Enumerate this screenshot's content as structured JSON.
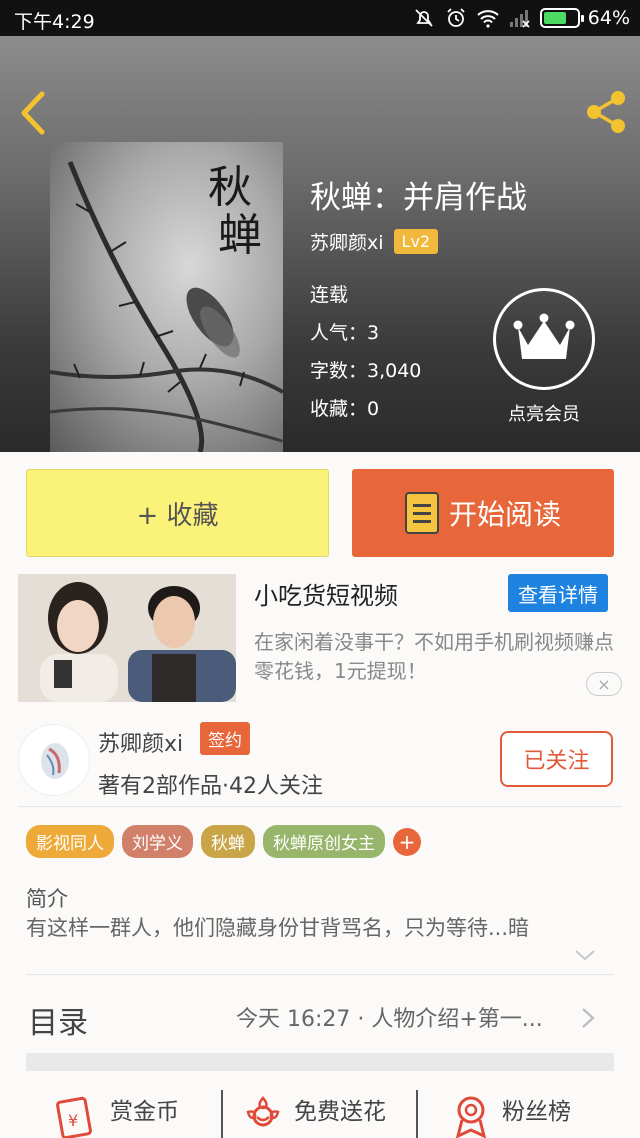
{
  "status_bar": {
    "time": "下午4:29",
    "battery": "64%"
  },
  "book": {
    "title": "秋蝉：并肩作战",
    "author": "苏卿颜xi",
    "level": "Lv2",
    "status": "连载",
    "popularity": "人气：3",
    "word_count": "字数：3,040",
    "favorites": "收藏：0",
    "cover_title": "秋蝉"
  },
  "vip": {
    "label": "点亮会员"
  },
  "actions": {
    "collect": "+ 收藏",
    "read": "开始阅读"
  },
  "ad": {
    "title": "小吃货短视频",
    "button": "查看详情",
    "description": "在家闲着没事干？不如用手机刷视频赚点零花钱，1元提现！",
    "close": "×"
  },
  "author_card": {
    "name": "苏卿颜xi",
    "badge": "签约",
    "stats": "著有2部作品·42人关注",
    "follow": "已关注"
  },
  "tags": [
    {
      "label": "影视同人",
      "color": "#eeaa38"
    },
    {
      "label": "刘学义",
      "color": "#d1806a"
    },
    {
      "label": "秋蝉",
      "color": "#c9a548"
    },
    {
      "label": "秋蝉原创女主",
      "color": "#98b56c"
    }
  ],
  "intro": {
    "title": "简介",
    "text": "有这样一群人，他们隐藏身份甘背骂名，只为等待...暗"
  },
  "catalog": {
    "label": "目录",
    "latest": "今天 16:27 · 人物介绍+第一..."
  },
  "bottom_bar": [
    {
      "label": "赏金币",
      "icon": "reward-icon"
    },
    {
      "label": "免费送花",
      "icon": "flower-icon"
    },
    {
      "label": "粉丝榜",
      "icon": "fans-rank-icon"
    }
  ],
  "colors": {
    "accent": "#e8673a",
    "collect": "#fbf27a",
    "ad_button": "#1e83e0",
    "vip_badge": "#f0b93c"
  }
}
